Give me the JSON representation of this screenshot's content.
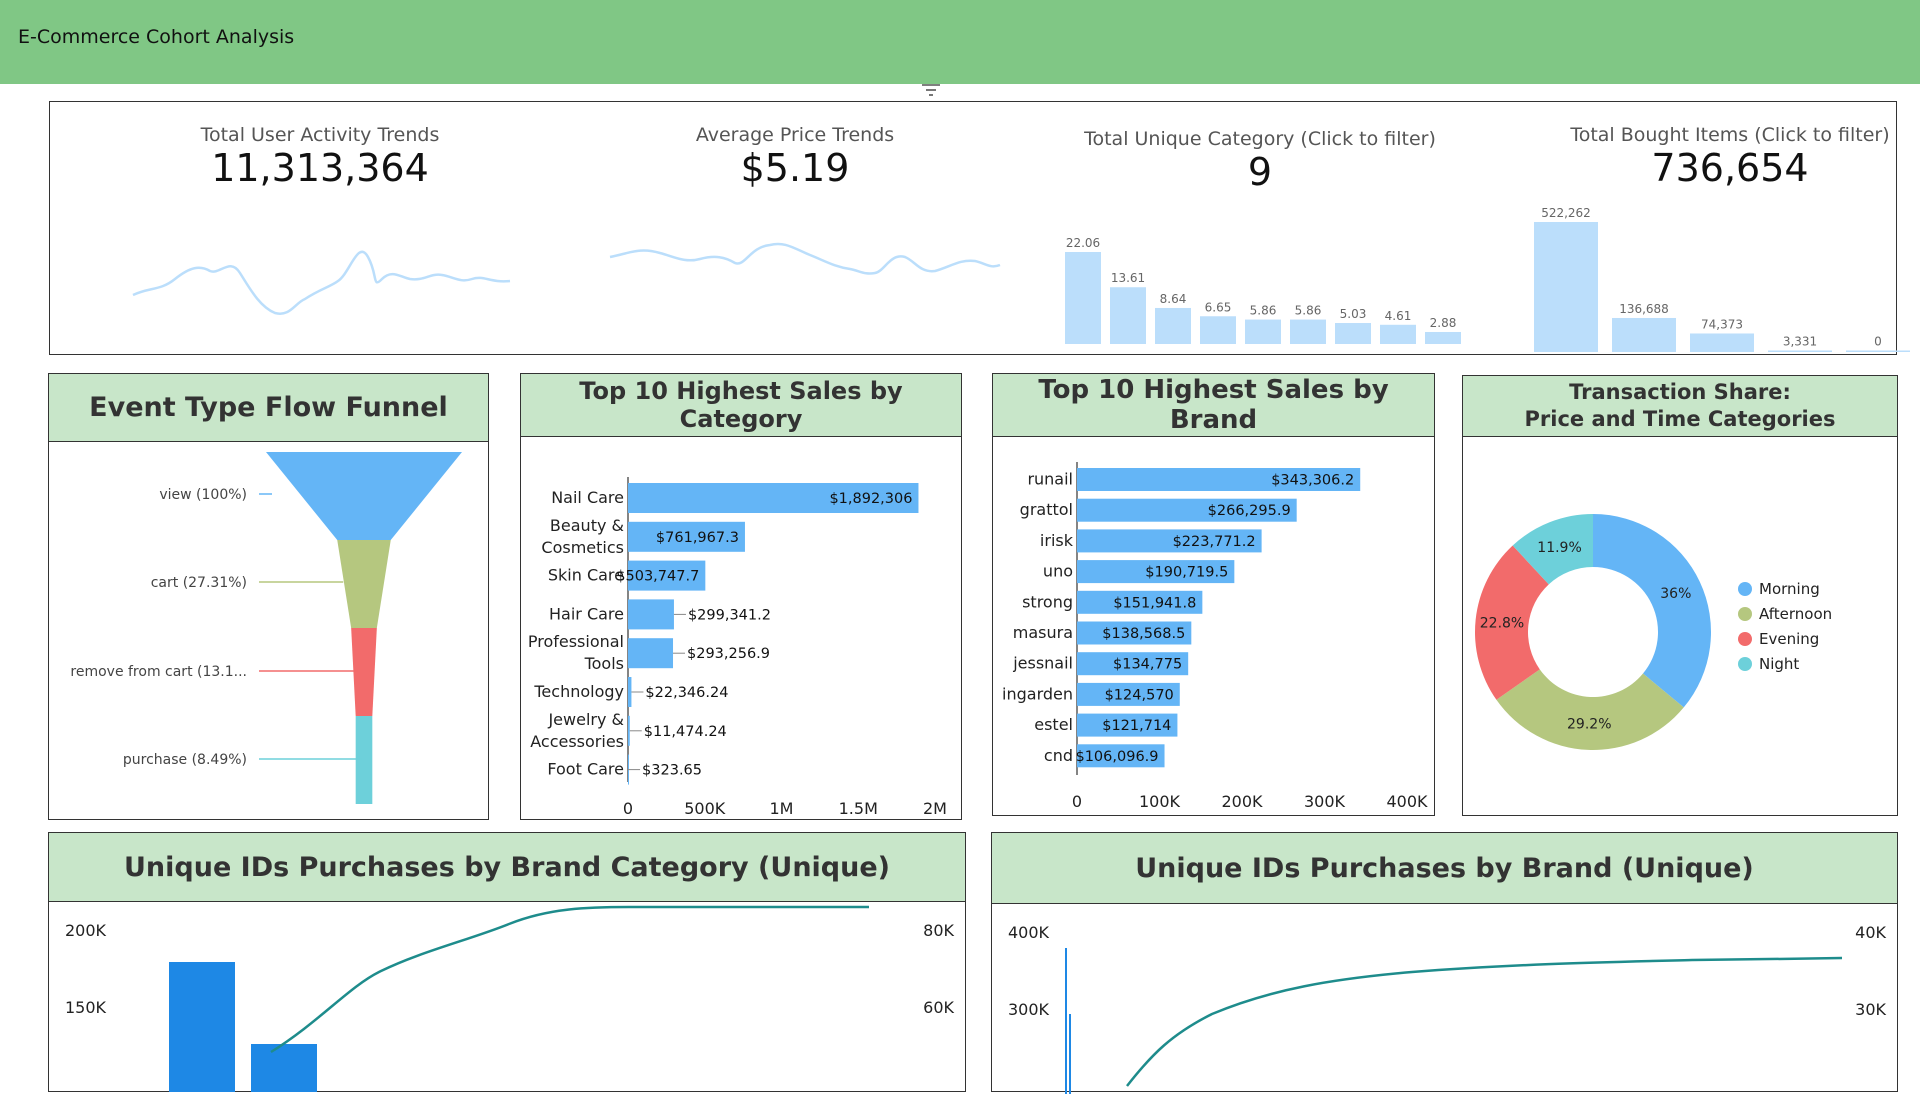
{
  "app": {
    "title": "E-Commerce Cohort Analysis"
  },
  "colors": {
    "header": "#80c785",
    "panel_header": "#c8e6c9",
    "bar": "#64b5f6",
    "kpi_spark": "#bbdefb",
    "line": "#1e8c8c"
  },
  "kpis": [
    {
      "title": "Total User Activity Trends",
      "value": "11,313,364"
    },
    {
      "title": "Average Price Trends",
      "value": "$5.19"
    },
    {
      "title": "Total Unique Category (Click to filter)",
      "value": "9"
    },
    {
      "title": "Total Bought Items (Click to filter)",
      "value": "736,654"
    }
  ],
  "kpi_mini_bars": {
    "category": {
      "values": [
        22.06,
        13.61,
        8.64,
        6.65,
        5.86,
        5.86,
        5.03,
        4.61,
        2.88
      ],
      "labels": [
        "22.06",
        "13.61",
        "8.64",
        "6.65",
        "5.86",
        "5.86",
        "5.03",
        "4.61",
        "2.88"
      ]
    },
    "bought": {
      "values": [
        522262,
        136688,
        74373,
        3331,
        0
      ],
      "labels": [
        "522,262",
        "136,688",
        "74,373",
        "3,331",
        "0"
      ]
    }
  },
  "panels": {
    "funnel": {
      "title": "Event Type Flow Funnel"
    },
    "category": {
      "title": "Top 10 Highest Sales by Category"
    },
    "brand": {
      "title": "Top 10 Highest Sales by Brand"
    },
    "donut": {
      "title_line1": "Transaction Share:",
      "title_line2": "Price and Time Categories"
    },
    "brand_cat": {
      "title": "Unique IDs Purchases by Brand Category (Unique)"
    },
    "brand_unique": {
      "title": "Unique IDs Purchases by Brand (Unique)"
    }
  },
  "chart_data": [
    {
      "type": "funnel",
      "categories": [
        "view (100%)",
        "cart (27.31%)",
        "remove from cart (13.1...",
        "purchase (8.49%)"
      ],
      "values": [
        100,
        27.31,
        13.1,
        8.49
      ],
      "colors": [
        "#64b5f6",
        "#b5c77f",
        "#f26b6b",
        "#6dd0da"
      ]
    },
    {
      "type": "bar",
      "title": "Top 10 Highest Sales by Category",
      "categories": [
        "Nail Care",
        "Beauty & Cosmetics",
        "Skin Care",
        "Hair Care",
        "Professional Tools",
        "Technology",
        "Jewelry & Accessories",
        "Foot Care"
      ],
      "category_lines": [
        [
          "Nail Care"
        ],
        [
          "Beauty &",
          "Cosmetics"
        ],
        [
          "Skin Care"
        ],
        [
          "Hair Care"
        ],
        [
          "Professional",
          "Tools"
        ],
        [
          "Technology"
        ],
        [
          "Jewelry &",
          "Accessories"
        ],
        [
          "Foot Care"
        ]
      ],
      "values": [
        1892306,
        761967.3,
        503747.7,
        299341.2,
        293256.9,
        22346.24,
        11474.24,
        323.65
      ],
      "labels": [
        "$1,892,306",
        "$761,967.3",
        "$503,747.7",
        "$299,341.2",
        "$293,256.9",
        "$22,346.24",
        "$11,474.24",
        "$323.65"
      ],
      "xlim": [
        0,
        2000000
      ],
      "xticks": [
        "0",
        "500K",
        "1M",
        "1.5M",
        "2M"
      ]
    },
    {
      "type": "bar",
      "title": "Top 10 Highest Sales by Brand",
      "categories": [
        "runail",
        "grattol",
        "irisk",
        "uno",
        "strong",
        "masura",
        "jessnail",
        "ingarden",
        "estel",
        "cnd"
      ],
      "values": [
        343306.2,
        266295.9,
        223771.2,
        190719.5,
        151941.8,
        138568.5,
        134775,
        124570,
        121714,
        106096.9
      ],
      "labels": [
        "$343,306.2",
        "$266,295.9",
        "$223,771.2",
        "$190,719.5",
        "$151,941.8",
        "$138,568.5",
        "$134,775",
        "$124,570",
        "$121,714",
        "$106,096.9"
      ],
      "xlim": [
        0,
        400000
      ],
      "xticks": [
        "0",
        "100K",
        "200K",
        "300K",
        "400K"
      ]
    },
    {
      "type": "pie",
      "title": "Transaction Share: Price and Time Categories",
      "categories": [
        "Morning",
        "Afternoon",
        "Evening",
        "Night"
      ],
      "values": [
        36,
        29.2,
        22.8,
        11.9
      ],
      "labels": [
        "36%",
        "29.2%",
        "22.8%",
        "11.9%"
      ],
      "colors": [
        "#64b5f6",
        "#b5c77f",
        "#f26b6b",
        "#6dd0da"
      ],
      "legend": "right"
    },
    {
      "type": "bar",
      "title": "Unique IDs Purchases by Brand Category (Unique)",
      "yticks_left": [
        "200K",
        "150K"
      ],
      "yticks_right": [
        "80K",
        "60K"
      ]
    },
    {
      "type": "bar",
      "title": "Unique IDs Purchases by Brand (Unique)",
      "yticks_left": [
        "400K",
        "300K"
      ],
      "yticks_right": [
        "40K",
        "30K"
      ]
    }
  ]
}
